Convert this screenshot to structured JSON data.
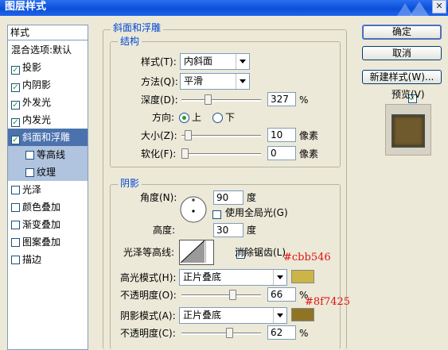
{
  "dialog": {
    "title": "图层样式",
    "close_icon": "✕"
  },
  "left_panel": {
    "header": "样式",
    "items": [
      {
        "label": "混合选项:默认",
        "checkbox": false,
        "checked": false,
        "state": "normal"
      },
      {
        "label": "投影",
        "checkbox": true,
        "checked": true,
        "state": "normal"
      },
      {
        "label": "内阴影",
        "checkbox": true,
        "checked": true,
        "state": "normal"
      },
      {
        "label": "外发光",
        "checkbox": true,
        "checked": true,
        "state": "normal"
      },
      {
        "label": "内发光",
        "checkbox": true,
        "checked": true,
        "state": "normal"
      },
      {
        "label": "斜面和浮雕",
        "checkbox": true,
        "checked": true,
        "state": "selected"
      },
      {
        "label": "等高线",
        "checkbox": true,
        "checked": false,
        "state": "sub"
      },
      {
        "label": "纹理",
        "checkbox": true,
        "checked": false,
        "state": "sub"
      },
      {
        "label": "光泽",
        "checkbox": true,
        "checked": false,
        "state": "normal"
      },
      {
        "label": "颜色叠加",
        "checkbox": true,
        "checked": false,
        "state": "normal"
      },
      {
        "label": "渐变叠加",
        "checkbox": true,
        "checked": false,
        "state": "normal"
      },
      {
        "label": "图案叠加",
        "checkbox": true,
        "checked": false,
        "state": "normal"
      },
      {
        "label": "描边",
        "checkbox": true,
        "checked": false,
        "state": "normal"
      }
    ]
  },
  "bevel": {
    "group_title": "斜面和浮雕",
    "structure": {
      "title": "结构",
      "style_label": "样式(T):",
      "style_value": "内斜面",
      "method_label": "方法(Q):",
      "method_value": "平滑",
      "depth_label": "深度(D):",
      "depth_value": "327",
      "depth_unit": "%",
      "depth_fraction": 0.32,
      "direction_label": "方向:",
      "direction_up": "上",
      "direction_down": "下",
      "direction_selected": "上",
      "size_label": "大小(Z):",
      "size_value": "10",
      "size_unit": "像素",
      "size_fraction": 0.04,
      "soften_label": "软化(F):",
      "soften_value": "0",
      "soften_unit": "像素",
      "soften_fraction": 0.0
    },
    "shading": {
      "title": "阴影",
      "angle_label": "角度(N):",
      "angle_value": "90",
      "angle_unit": "度",
      "global_light_label": "使用全局光(G)",
      "global_light_checked": false,
      "altitude_label": "高度:",
      "altitude_value": "30",
      "altitude_unit": "度",
      "gloss_contour_label": "光泽等高线:",
      "antialias_label": "消除锯齿(L)",
      "antialias_checked": false,
      "highlight_mode_label": "高光模式(H):",
      "highlight_mode_value": "正片叠底",
      "highlight_color": "#cbb546",
      "highlight_opacity_label": "不透明度(O):",
      "highlight_opacity_value": "66",
      "highlight_opacity_unit": "%",
      "highlight_opacity_fraction": 0.66,
      "shadow_mode_label": "阴影模式(A):",
      "shadow_mode_value": "正片叠底",
      "shadow_color": "#8f7425",
      "shadow_opacity_label": "不透明度(C):",
      "shadow_opacity_value": "62",
      "shadow_opacity_unit": "%",
      "shadow_opacity_fraction": 0.62
    }
  },
  "buttons": {
    "ok": "确定",
    "cancel": "取消",
    "new_style": "新建样式(W)...",
    "preview_label": "预览(V)",
    "preview_checked": true
  },
  "annotations": {
    "highlight_hex": "#cbb546",
    "shadow_hex": "#8f7425"
  }
}
